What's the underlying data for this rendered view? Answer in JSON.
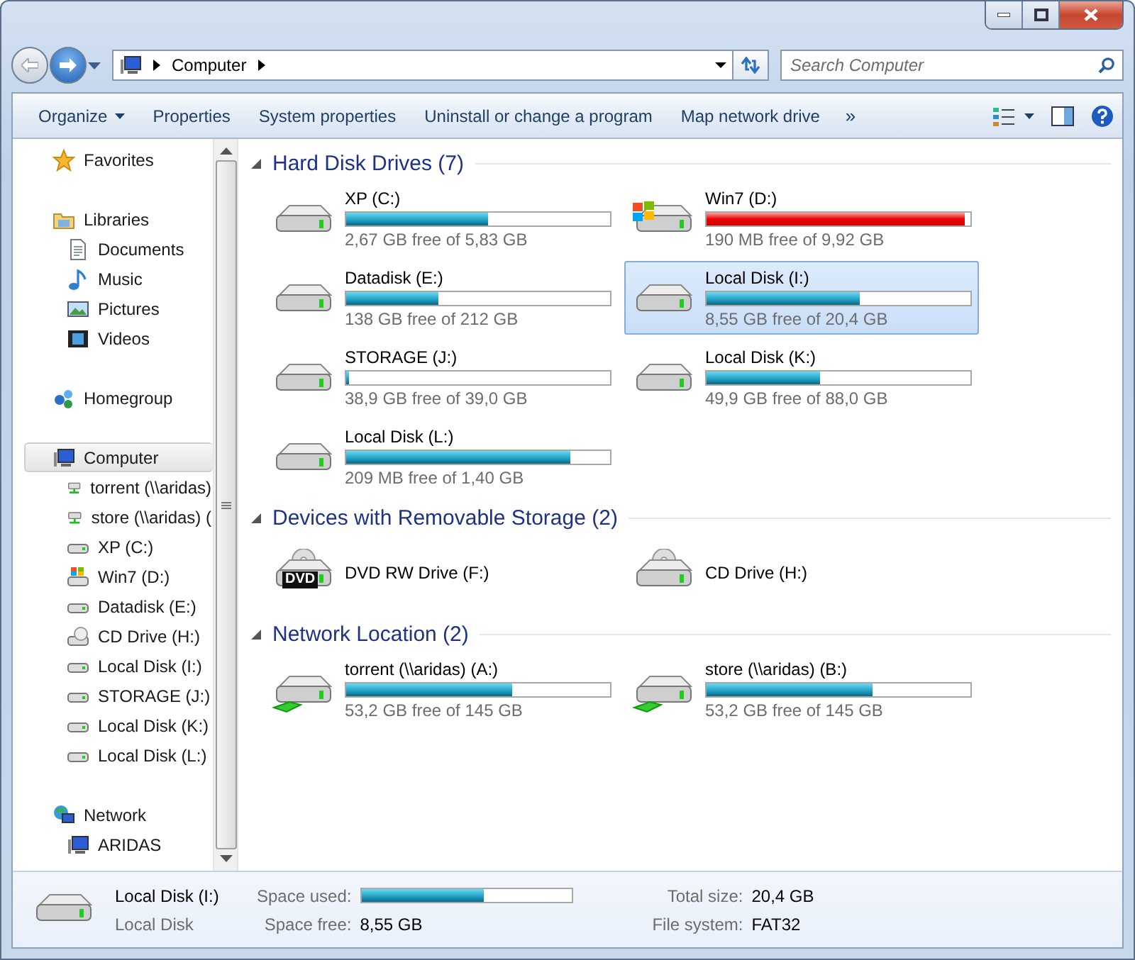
{
  "address_bar": {
    "path": [
      "Computer"
    ]
  },
  "search": {
    "placeholder": "Search Computer"
  },
  "toolbar": {
    "buttons": [
      {
        "label": "Organize",
        "dropdown": true
      },
      {
        "label": "Properties",
        "dropdown": false
      },
      {
        "label": "System properties",
        "dropdown": false
      },
      {
        "label": "Uninstall or change a program",
        "dropdown": false
      },
      {
        "label": "Map network drive",
        "dropdown": false
      }
    ],
    "overflow": "»"
  },
  "sidebar": {
    "items": [
      {
        "label": "Favorites",
        "kind": "star",
        "selected": false
      },
      {
        "label": "Libraries",
        "kind": "library",
        "selected": false,
        "children": [
          {
            "label": "Documents",
            "kind": "document",
            "selected": false
          },
          {
            "label": "Music",
            "kind": "music",
            "selected": false
          },
          {
            "label": "Pictures",
            "kind": "picture",
            "selected": false
          },
          {
            "label": "Videos",
            "kind": "video",
            "selected": false
          }
        ]
      },
      {
        "label": "Homegroup",
        "kind": "homegroup",
        "selected": false
      },
      {
        "label": "Computer",
        "kind": "computer",
        "selected": true,
        "children": [
          {
            "label": "torrent (\\\\aridas)",
            "kind": "network",
            "selected": false
          },
          {
            "label": "store (\\\\aridas) (",
            "kind": "network",
            "selected": false
          },
          {
            "label": "XP (C:)",
            "kind": "hdd",
            "selected": false
          },
          {
            "label": "Win7 (D:)",
            "kind": "os",
            "selected": false
          },
          {
            "label": "Datadisk (E:)",
            "kind": "hdd",
            "selected": false
          },
          {
            "label": "CD Drive (H:)",
            "kind": "cd",
            "selected": false
          },
          {
            "label": "Local Disk (I:)",
            "kind": "hdd",
            "selected": false
          },
          {
            "label": "STORAGE (J:)",
            "kind": "hdd",
            "selected": false
          },
          {
            "label": "Local Disk (K:)",
            "kind": "hdd",
            "selected": false
          },
          {
            "label": "Local Disk (L:)",
            "kind": "hdd",
            "selected": false
          }
        ]
      },
      {
        "label": "Network",
        "kind": "globe",
        "selected": false,
        "children": [
          {
            "label": "ARIDAS",
            "kind": "computer",
            "selected": false
          }
        ]
      }
    ]
  },
  "groups": [
    {
      "title": "Hard Disk Drives (7)",
      "expanded": true,
      "items": [
        {
          "name": "XP (C:)",
          "kind": "hdd",
          "level": 0.54,
          "critical": false,
          "free": "2,67 GB free of 5,83 GB",
          "selected": false
        },
        {
          "name": "Win7 (D:)",
          "kind": "os",
          "level": 0.98,
          "critical": true,
          "free": "190 MB free of 9,92 GB",
          "selected": false
        },
        {
          "name": "Datadisk (E:)",
          "kind": "hdd",
          "level": 0.35,
          "critical": false,
          "free": "138 GB free of 212 GB",
          "selected": false
        },
        {
          "name": "Local Disk (I:)",
          "kind": "hdd",
          "level": 0.58,
          "critical": false,
          "free": "8,55 GB free of 20,4 GB",
          "selected": true
        },
        {
          "name": "STORAGE (J:)",
          "kind": "hdd",
          "level": 0.01,
          "critical": false,
          "free": "38,9 GB free of 39,0 GB",
          "selected": false
        },
        {
          "name": "Local Disk (K:)",
          "kind": "hdd",
          "level": 0.43,
          "critical": false,
          "free": "49,9 GB free of 88,0 GB",
          "selected": false
        },
        {
          "name": "Local Disk (L:)",
          "kind": "hdd",
          "level": 0.85,
          "critical": false,
          "free": "209 MB free of 1,40 GB",
          "selected": false
        }
      ]
    },
    {
      "title": "Devices with Removable Storage (2)",
      "expanded": true,
      "items": [
        {
          "name": "DVD RW Drive (F:)",
          "kind": "dvd",
          "badge": "DVD",
          "selected": false
        },
        {
          "name": "CD Drive (H:)",
          "kind": "cd",
          "selected": false
        }
      ]
    },
    {
      "title": "Network Location (2)",
      "expanded": true,
      "items": [
        {
          "name": "torrent (\\\\aridas) (A:)",
          "kind": "network",
          "level": 0.63,
          "critical": false,
          "free": "53,2 GB free of 145 GB",
          "selected": false
        },
        {
          "name": "store (\\\\aridas) (B:)",
          "kind": "network",
          "level": 0.63,
          "critical": false,
          "free": "53,2 GB free of 145 GB",
          "selected": false
        }
      ]
    }
  ],
  "details": {
    "kind": "hdd",
    "name": "Local Disk (I:)",
    "type": "Local Disk",
    "fields": [
      {
        "label": "Space used:",
        "level": 0.58
      },
      {
        "label": "Total size:",
        "value": "20,4 GB"
      },
      {
        "label": "Space free:",
        "value": "8,55 GB"
      },
      {
        "label": "File system:",
        "value": "FAT32"
      }
    ]
  }
}
